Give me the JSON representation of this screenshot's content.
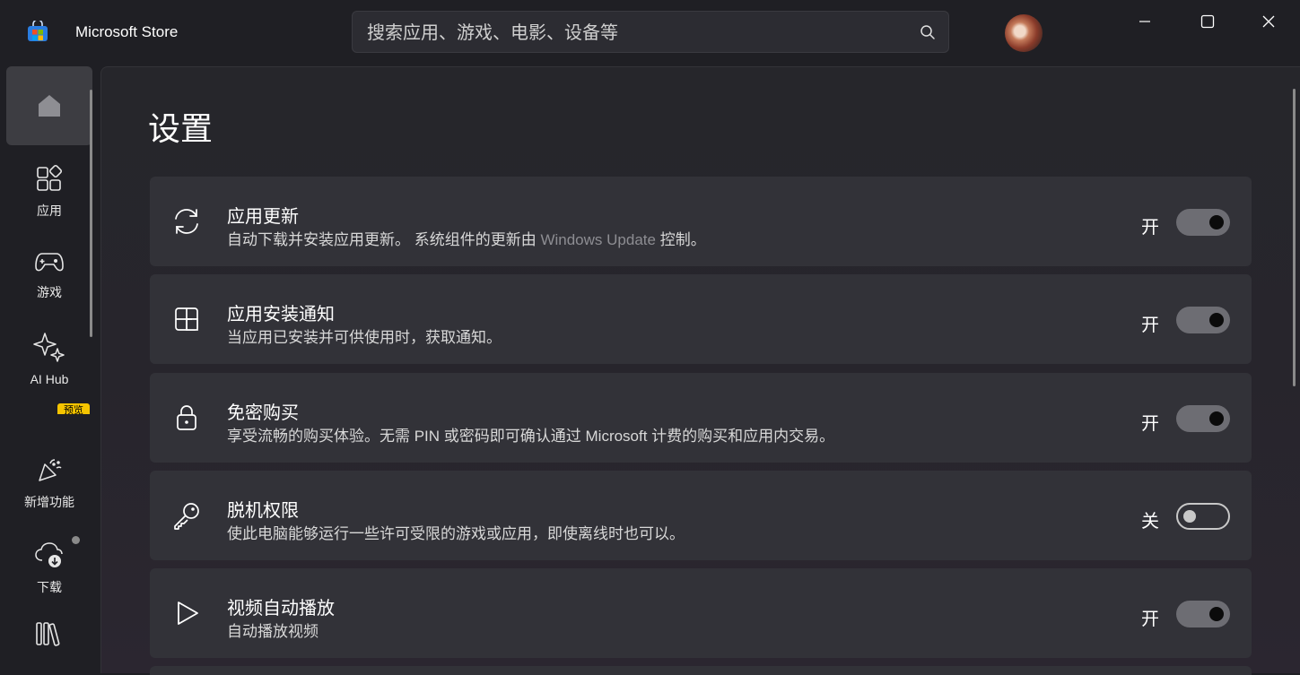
{
  "app": {
    "title": "Microsoft Store"
  },
  "search": {
    "placeholder": "搜索应用、游戏、电影、设备等"
  },
  "window": {
    "minimize": "minimize",
    "maximize": "maximize",
    "close": "close"
  },
  "nav": {
    "items": [
      {
        "label": "",
        "icon": "home-icon"
      },
      {
        "label": "应用",
        "icon": "apps-icon"
      },
      {
        "label": "游戏",
        "icon": "gamepad-icon"
      },
      {
        "label": "AI Hub",
        "icon": "sparkle-icon"
      },
      {
        "label": "新增功能",
        "icon": "party-icon"
      },
      {
        "label": "下载",
        "icon": "cloud-download-icon"
      },
      {
        "label": "",
        "icon": "library-icon"
      }
    ],
    "preview_badge": "预览"
  },
  "page": {
    "title": "设置"
  },
  "settings": [
    {
      "title": "应用更新",
      "desc_before": "自动下载并安装应用更新。 系统组件的更新由 ",
      "desc_link": "Windows Update",
      "desc_after": " 控制。",
      "state": "开",
      "on": true,
      "icon": "refresh-icon"
    },
    {
      "title": "应用安装通知",
      "desc": "当应用已安装并可供使用时，获取通知。",
      "state": "开",
      "on": true,
      "icon": "notification-layout-icon"
    },
    {
      "title": "免密购买",
      "desc": "享受流畅的购买体验。无需 PIN 或密码即可确认通过 Microsoft 计费的购买和应用内交易。",
      "state": "开",
      "on": true,
      "icon": "lock-icon"
    },
    {
      "title": "脱机权限",
      "desc": "使此电脑能够运行一些许可受限的游戏或应用，即使离线时也可以。",
      "state": "关",
      "on": false,
      "icon": "key-icon"
    },
    {
      "title": "视频自动播放",
      "desc": "自动播放视频",
      "state": "开",
      "on": true,
      "icon": "play-icon"
    }
  ]
}
